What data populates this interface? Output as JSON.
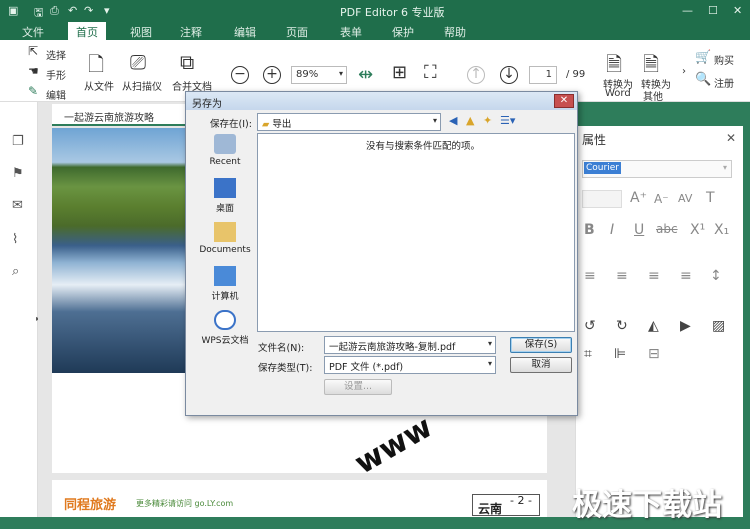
{
  "app": {
    "title": "PDF Editor 6 专业版",
    "window_controls": [
      "—",
      "☐",
      "✕"
    ]
  },
  "menu": {
    "items": [
      "文件",
      "首页",
      "视图",
      "注释",
      "编辑",
      "页面",
      "表单",
      "保护",
      "帮助"
    ],
    "active": "首页"
  },
  "ribbon": {
    "tools": {
      "select": "选择",
      "hand": "手形",
      "edit": "编辑"
    },
    "from_file": "从文件",
    "from_scanner": "从扫描仪",
    "merge_docs": "合并文档",
    "zoom": "89%",
    "page_current": "1",
    "page_total": "/ 99",
    "convert_word": [
      "转换为",
      "Word"
    ],
    "convert_other": [
      "转换为",
      "其他"
    ],
    "buy": "购买",
    "register": "注册"
  },
  "document": {
    "tab_title": "一起游云南旅游攻略",
    "watermark": "www",
    "footer_logo": "同程旅游",
    "footer_slogan": "更多精彩请访问 go.LY.com",
    "footer_tag": "云南",
    "page_marker": "- 2 -"
  },
  "properties": {
    "title": "属性",
    "font": "Courier",
    "format_buttons": [
      "B",
      "I",
      "U",
      "abc",
      "X¹",
      "X₁"
    ]
  },
  "dialog": {
    "title": "另存为",
    "save_in_label": "保存在(I):",
    "save_in_value": "导出",
    "empty_message": "没有与搜索条件匹配的项。",
    "places": [
      "Recent",
      "桌面",
      "Documents",
      "计算机",
      "WPS云文档"
    ],
    "filename_label": "文件名(N):",
    "filename_value": "一起游云南旅游攻略-复制.pdf",
    "filetype_label": "保存类型(T):",
    "filetype_value": "PDF 文件 (*.pdf)",
    "save_button": "保存(S)",
    "cancel_button": "取消",
    "settings_button": "设置..."
  },
  "corner_watermark": "极速下载站"
}
